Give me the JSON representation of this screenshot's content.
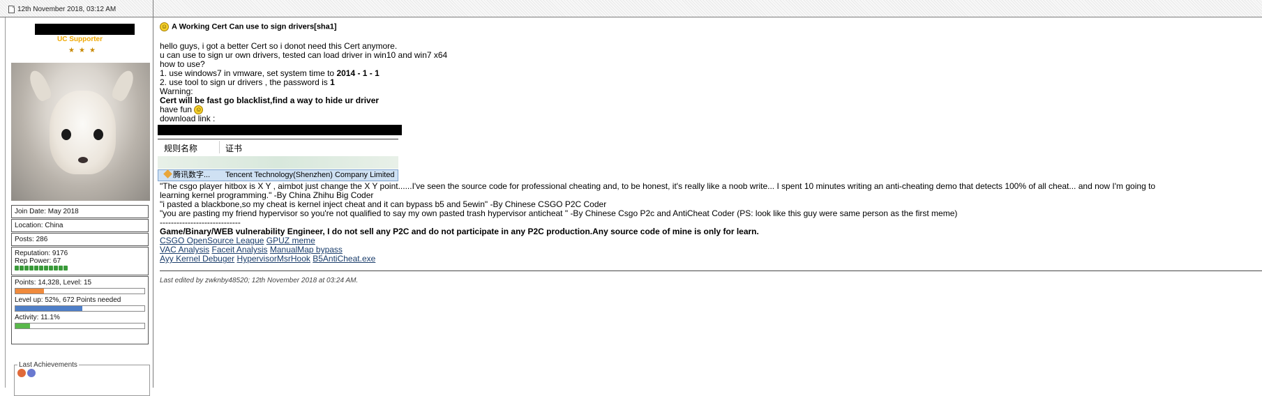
{
  "header": {
    "date": "12th November 2018, 03:12 AM"
  },
  "user": {
    "title": "UC Supporter",
    "stars": [
      "★",
      "★",
      "★"
    ],
    "join_date": "Join Date: May 2018",
    "location": "Location: China",
    "posts": "Posts: 286",
    "reputation": "Reputation: 9176",
    "rep_power": "Rep Power: 67",
    "points": "Points: 14,328, Level: 15",
    "points_fill": 0.22,
    "level_up": "Level up: 52%, 672 Points needed",
    "level_up_fill": 0.52,
    "activity": "Activity: 11.1%",
    "activity_fill": 0.111,
    "achievements_legend": "Last Achievements"
  },
  "post": {
    "title": "A Working Cert Can use to sign drivers[sha1]",
    "lines": {
      "l1": "hello guys,  i got a better Cert so i donot need this Cert anymore.",
      "l2": "u can use to sign ur own drivers, tested can load driver in win10 and win7 x64",
      "l3": "how to use?",
      "l4_pre": "1. use windows7 in vmware, set system time to ",
      "l4_bold": "2014 - 1 - 1",
      "l5_pre": "2. use tool to sign ur drivers , the password is ",
      "l5_bold": "1",
      "l6": "Warning:",
      "l7_bold": "Cert will be fast go blacklist,find a way to hide ur driver",
      "l8": "have fun",
      "l9": "download link :"
    },
    "cert_table": {
      "col1": "规则名称",
      "col2": "证书",
      "row_name": "腾讯数字...",
      "row_cert": "Tencent Technology(Shenzhen) Company Limited"
    },
    "signature": {
      "q1": "\"The csgo player hitbox is X Y , aimbot just change the X Y point......I've seen the source code for professional cheating and, to be honest, it's really like a noob write... I spent 10 minutes writing an anti-cheating demo that detects 100% of all cheat... and now I'm going to",
      "q1b": "learning kernel programming.\" -By China Zhihu Big Coder",
      "q2": "\"i pasted a blackbone,so my cheat is kernel inject cheat and it can bypass b5 and 5ewin\" -By Chinese CSGO P2C Coder",
      "q3": "\"you are pasting my friend hypervisor so you're not qualified to say my own pasted trash hypervisor anticheat \" -By Chinese Csgo P2c and AntiCheat Coder (PS: look like this guy were same person as the first meme)",
      "dashes": "-----------------------------",
      "bold_line": "Game/Binary/WEB vulnerability Engineer, I do not sell any P2C and do not participate in any P2C production.Any source code of mine is only for learn.",
      "links_row1": [
        "CSGO OpenSource League",
        "GPUZ meme"
      ],
      "links_row2": [
        "VAC Analysis",
        "Faceit Analysis",
        "ManualMap bypass"
      ],
      "links_row3": [
        "Ayy Kernel Debuger",
        "HypervisorMsrHook",
        "B5AntiCheat.exe"
      ]
    },
    "edited": "Last edited by zwknby48520; 12th November 2018 at 03:24 AM."
  },
  "colors": {
    "title_gold": "#f0a800",
    "points_bar": "#f08a3c",
    "level_bar": "#4f7fc8",
    "activity_bar": "#59b84a",
    "link": "#1a3d6b"
  }
}
